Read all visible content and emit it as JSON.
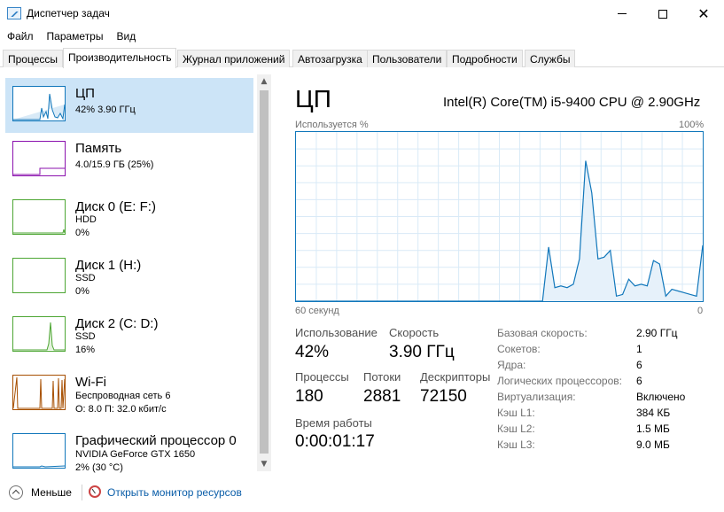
{
  "window": {
    "title": "Диспетчер задач",
    "controls": {
      "minimize": "minimize-icon",
      "maximize": "maximize-icon",
      "close": "close-icon"
    }
  },
  "menu": [
    "Файл",
    "Параметры",
    "Вид"
  ],
  "tabs": [
    "Процессы",
    "Производительность",
    "Журнал приложений",
    "Автозагрузка",
    "Пользователи",
    "Подробности",
    "Службы"
  ],
  "active_tab": "Производительность",
  "sidebar": {
    "items": [
      {
        "name": "ЦП",
        "line1": "42% 3.90 ГГц",
        "line2": "",
        "color": "#1177bb"
      },
      {
        "name": "Память",
        "line1": "4.0/15.9 ГБ (25%)",
        "line2": "",
        "color": "#8b12ae"
      },
      {
        "name": "Диск 0 (E: F:)",
        "line1": "HDD",
        "line2": "0%",
        "color": "#4da633"
      },
      {
        "name": "Диск 1 (H:)",
        "line1": "SSD",
        "line2": "0%",
        "color": "#4da633"
      },
      {
        "name": "Диск 2 (C: D:)",
        "line1": "SSD",
        "line2": "16%",
        "color": "#4da633"
      },
      {
        "name": "Wi-Fi",
        "line1": "Беспроводная сеть 6",
        "line2": "О: 8.0  П: 32.0 кбит/с",
        "color": "#a74f01"
      },
      {
        "name": "Графический процессор 0",
        "line1": "NVIDIA GeForce GTX 1650",
        "line2": "2% (30 °C)",
        "color": "#1177bb"
      }
    ]
  },
  "main": {
    "title": "ЦП",
    "model": "Intel(R) Core(TM) i5-9400 CPU @ 2.90GHz",
    "graph_label": "Используется %",
    "graph_max": "100%",
    "time_span": "60 секунд",
    "time_zero": "0",
    "stats": {
      "usage_label": "Использование",
      "usage_value": "42%",
      "speed_label": "Скорость",
      "speed_value": "3.90 ГГц",
      "processes_label": "Процессы",
      "processes_value": "180",
      "threads_label": "Потоки",
      "threads_value": "2881",
      "handles_label": "Дескрипторы",
      "handles_value": "72150",
      "uptime_label": "Время работы",
      "uptime_value": "0:00:01:17"
    },
    "details": [
      {
        "key": "Базовая скорость:",
        "value": "2.90 ГГц"
      },
      {
        "key": "Сокетов:",
        "value": "1"
      },
      {
        "key": "Ядра:",
        "value": "6"
      },
      {
        "key": "Логических процессоров:",
        "value": "6"
      },
      {
        "key": "Виртуализация:",
        "value": "Включено"
      },
      {
        "key": "Кэш L1:",
        "value": "384 КБ"
      },
      {
        "key": "Кэш L2:",
        "value": "1.5 МБ"
      },
      {
        "key": "Кэш L3:",
        "value": "9.0 МБ"
      }
    ]
  },
  "footer": {
    "less_label": "Меньше",
    "monitor_link": "Открыть монитор ресурсов"
  },
  "cpu_history_percent": [
    0,
    0,
    0,
    0,
    0,
    0,
    0,
    0,
    0,
    0,
    0,
    0,
    0,
    0,
    0,
    0,
    0,
    0,
    0,
    0,
    0,
    0,
    0,
    0,
    0,
    0,
    0,
    0,
    0,
    0,
    0,
    0,
    0,
    0,
    0,
    0,
    0,
    0,
    0,
    0,
    0,
    32,
    8,
    9,
    8,
    10,
    25,
    83,
    64,
    25,
    26,
    30,
    3,
    4,
    13,
    9,
    10,
    9,
    24,
    22,
    3,
    7,
    6,
    5,
    4,
    3,
    33
  ]
}
